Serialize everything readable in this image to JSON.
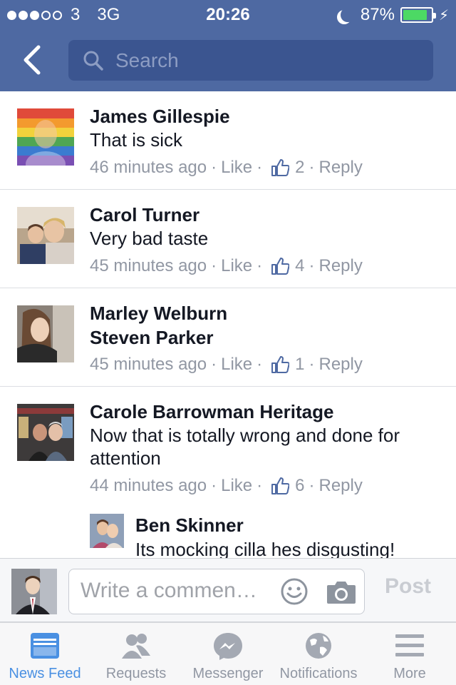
{
  "status_bar": {
    "carrier": "3",
    "network": "3G",
    "time": "20:26",
    "battery": "87%",
    "battery_level": 0.87
  },
  "header": {
    "search_placeholder": "Search"
  },
  "comments": [
    {
      "author": "James Gillespie",
      "text": "That is sick",
      "time": "46 minutes ago",
      "like_label": "Like",
      "likes": "2",
      "reply_label": "Reply"
    },
    {
      "author": "Carol Turner",
      "text": "Very bad taste",
      "time": "45 minutes ago",
      "like_label": "Like",
      "likes": "4",
      "reply_label": "Reply"
    },
    {
      "author": "Marley Welburn",
      "text": "Steven Parker",
      "time": "45 minutes ago",
      "like_label": "Like",
      "likes": "1",
      "reply_label": "Reply"
    },
    {
      "author": "Carole Barrowman Heritage",
      "text": "Now that is totally wrong and done for attention",
      "time": "44 minutes ago",
      "like_label": "Like",
      "likes": "6",
      "reply_label": "Reply"
    }
  ],
  "reply": {
    "author": "Ben Skinner",
    "text": "Its mocking cilla hes disgusting!"
  },
  "composer": {
    "placeholder": "Write a commen…",
    "post_label": "Post"
  },
  "tabbar": {
    "items": [
      {
        "label": "News Feed",
        "icon": "news-feed-icon",
        "active": true
      },
      {
        "label": "Requests",
        "icon": "friend-requests-icon"
      },
      {
        "label": "Messenger",
        "icon": "messenger-icon"
      },
      {
        "label": "Notifications",
        "icon": "globe-icon"
      },
      {
        "label": "More",
        "icon": "menu-icon"
      }
    ]
  },
  "colors": {
    "header_bg": "#4e69a2",
    "search_bg": "#3b5590",
    "meta_text": "#9197a3",
    "active_tab": "#4a90e2",
    "battery": "#4cd964"
  }
}
